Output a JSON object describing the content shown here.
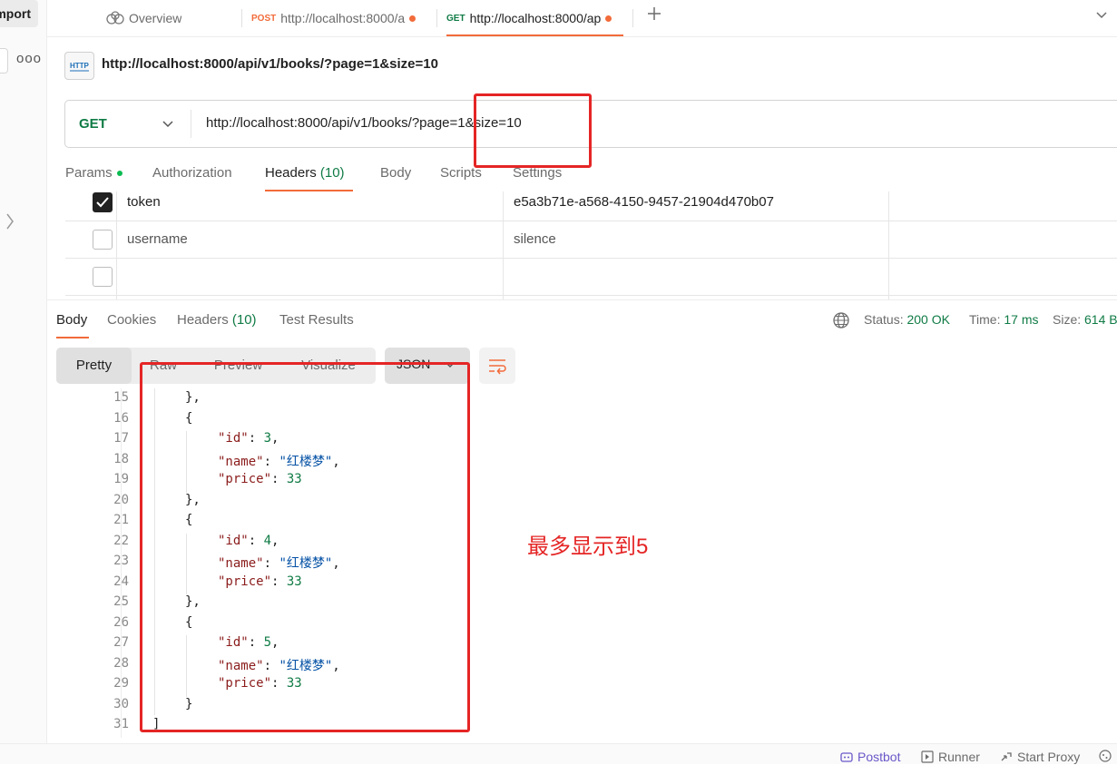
{
  "sidebar": {
    "import_label": "Import",
    "more_label": "ooo"
  },
  "tabs": [
    {
      "label": "Overview"
    },
    {
      "method": "POST",
      "label": "http://localhost:8000/a",
      "method_color": "#f26b3a"
    },
    {
      "method": "GET",
      "label": "http://localhost:8000/ap",
      "method_color": "#0f7b45"
    }
  ],
  "request": {
    "title": "http://localhost:8000/api/v1/books/?page=1&size=10",
    "method": "GET",
    "url": "http://localhost:8000/api/v1/books/?page=1&size=10",
    "tabs": {
      "params": "Params",
      "authorization": "Authorization",
      "headers": "Headers",
      "headers_count": "(10)",
      "body": "Body",
      "scripts": "Scripts",
      "settings": "Settings"
    }
  },
  "headers_table": {
    "rows": [
      {
        "checked": true,
        "key": "token",
        "value": "e5a3b71e-a568-4150-9457-21904d470b07"
      },
      {
        "checked": false,
        "key": "username",
        "value": "silence"
      },
      {
        "checked": false,
        "key": "",
        "value": ""
      }
    ]
  },
  "response": {
    "tabs": {
      "body": "Body",
      "cookies": "Cookies",
      "headers": "Headers",
      "headers_count": "(10)",
      "test_results": "Test Results"
    },
    "status_label": "Status:",
    "status_value": "200 OK",
    "time_label": "Time:",
    "time_value": "17 ms",
    "size_label": "Size:",
    "size_value": "614 B",
    "view_modes": {
      "pretty": "Pretty",
      "raw": "Raw",
      "preview": "Preview",
      "visualize": "Visualize"
    },
    "format": "JSON",
    "code_lines": [
      {
        "n": "15",
        "text": "},"
      },
      {
        "n": "16",
        "text": "{"
      },
      {
        "n": "17",
        "key": "\"id\"",
        "val": "3",
        "type": "num",
        "comma": ","
      },
      {
        "n": "18",
        "key": "\"name\"",
        "val": "\"红楼梦\"",
        "type": "str",
        "comma": ","
      },
      {
        "n": "19",
        "key": "\"price\"",
        "val": "33",
        "type": "num",
        "comma": ""
      },
      {
        "n": "20",
        "text": "},"
      },
      {
        "n": "21",
        "text": "{"
      },
      {
        "n": "22",
        "key": "\"id\"",
        "val": "4",
        "type": "num",
        "comma": ","
      },
      {
        "n": "23",
        "key": "\"name\"",
        "val": "\"红楼梦\"",
        "type": "str",
        "comma": ","
      },
      {
        "n": "24",
        "key": "\"price\"",
        "val": "33",
        "type": "num",
        "comma": ""
      },
      {
        "n": "25",
        "text": "},"
      },
      {
        "n": "26",
        "text": "{"
      },
      {
        "n": "27",
        "key": "\"id\"",
        "val": "5",
        "type": "num",
        "comma": ","
      },
      {
        "n": "28",
        "key": "\"name\"",
        "val": "\"红楼梦\"",
        "type": "str",
        "comma": ","
      },
      {
        "n": "29",
        "key": "\"price\"",
        "val": "33",
        "type": "num",
        "comma": ""
      },
      {
        "n": "30",
        "text": "}"
      },
      {
        "n": "31",
        "text": "]"
      }
    ]
  },
  "annotation": {
    "text": "最多显示到5",
    "color": "#e52525"
  },
  "footer": {
    "postbot": "Postbot",
    "runner": "Runner",
    "start_proxy": "Start Proxy"
  },
  "colors": {
    "accent": "#f26b3a",
    "success": "#0f7b45",
    "annotation": "#e52525"
  }
}
